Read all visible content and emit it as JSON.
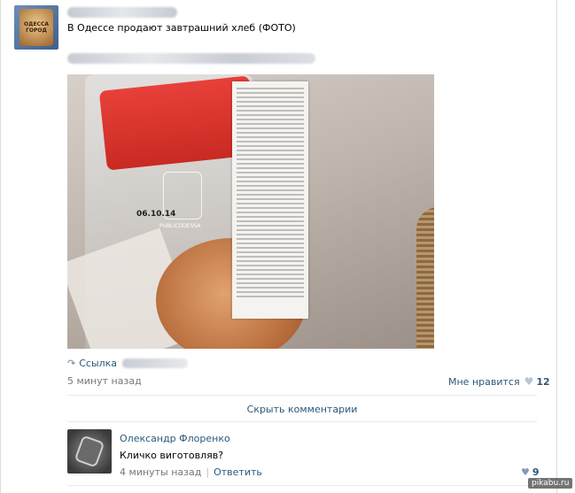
{
  "post": {
    "group_avatar_label_line1": "ОДЕССА",
    "group_avatar_label_line2": "ГОРОД",
    "text": "В Одессе продают завтрашний хлеб (ФОТО)",
    "photo": {
      "stamp_date": "06.10.14",
      "watermark_text": "PUBLICODESSA"
    },
    "link_label": "Ссылка",
    "time": "5 минут назад",
    "like_label": "Мне нравится",
    "like_count": "12"
  },
  "comments_toggle": "Скрыть комментарии",
  "comment": {
    "author": "Олександр Флоренко",
    "text": "Кличко виготовляв?",
    "time": "4 минуты назад",
    "reply_label": "Ответить",
    "like_count": "9"
  },
  "site_watermark": "pikabu.ru",
  "icons": {
    "link": "share-arrow-icon",
    "like": "heart-icon"
  }
}
